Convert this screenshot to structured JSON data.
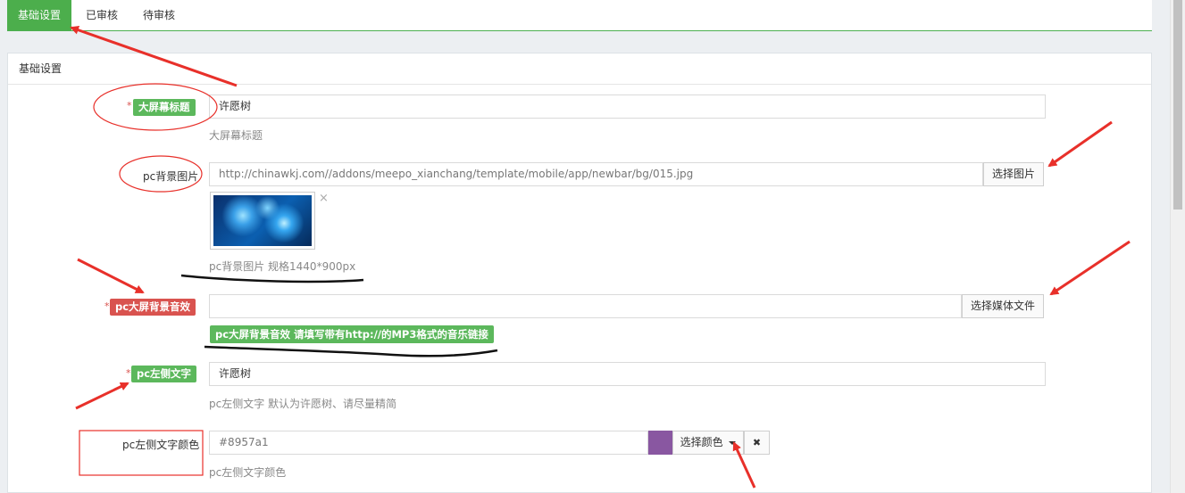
{
  "tabs": [
    {
      "label": "基础设置",
      "active": true
    },
    {
      "label": "已审核",
      "active": false
    },
    {
      "label": "待审核",
      "active": false
    }
  ],
  "panel": {
    "title": "基础设置"
  },
  "fields": {
    "screen_title": {
      "label": "大屏幕标题",
      "required": "*",
      "value": "许愿树",
      "help": "大屏幕标题"
    },
    "pc_bg": {
      "label": "pc背景图片",
      "value": "http://chinawkj.com//addons/meepo_xianchang/template/mobile/app/newbar/bg/015.jpg",
      "button": "选择图片",
      "remove": "×",
      "help": "pc背景图片 规格1440*900px"
    },
    "pc_audio": {
      "label": "pc大屏背景音效",
      "required": "*",
      "value": "",
      "button": "选择媒体文件",
      "help": "pc大屏背景音效 请填写带有http://的MP3格式的音乐链接"
    },
    "pc_left_text": {
      "label": "pc左侧文字",
      "required": "*",
      "value": "许愿树",
      "help": "pc左侧文字 默认为许愿树、请尽量精简"
    },
    "pc_left_color": {
      "label": "pc左侧文字颜色",
      "value": "#8957a1",
      "swatch": "#8957a1",
      "button": "选择颜色",
      "clear": "✖",
      "help": "pc左侧文字颜色"
    }
  },
  "colors": {
    "accent_green": "#5cb85c",
    "accent_red": "#d9534f",
    "annotation_red": "#e8302a"
  }
}
